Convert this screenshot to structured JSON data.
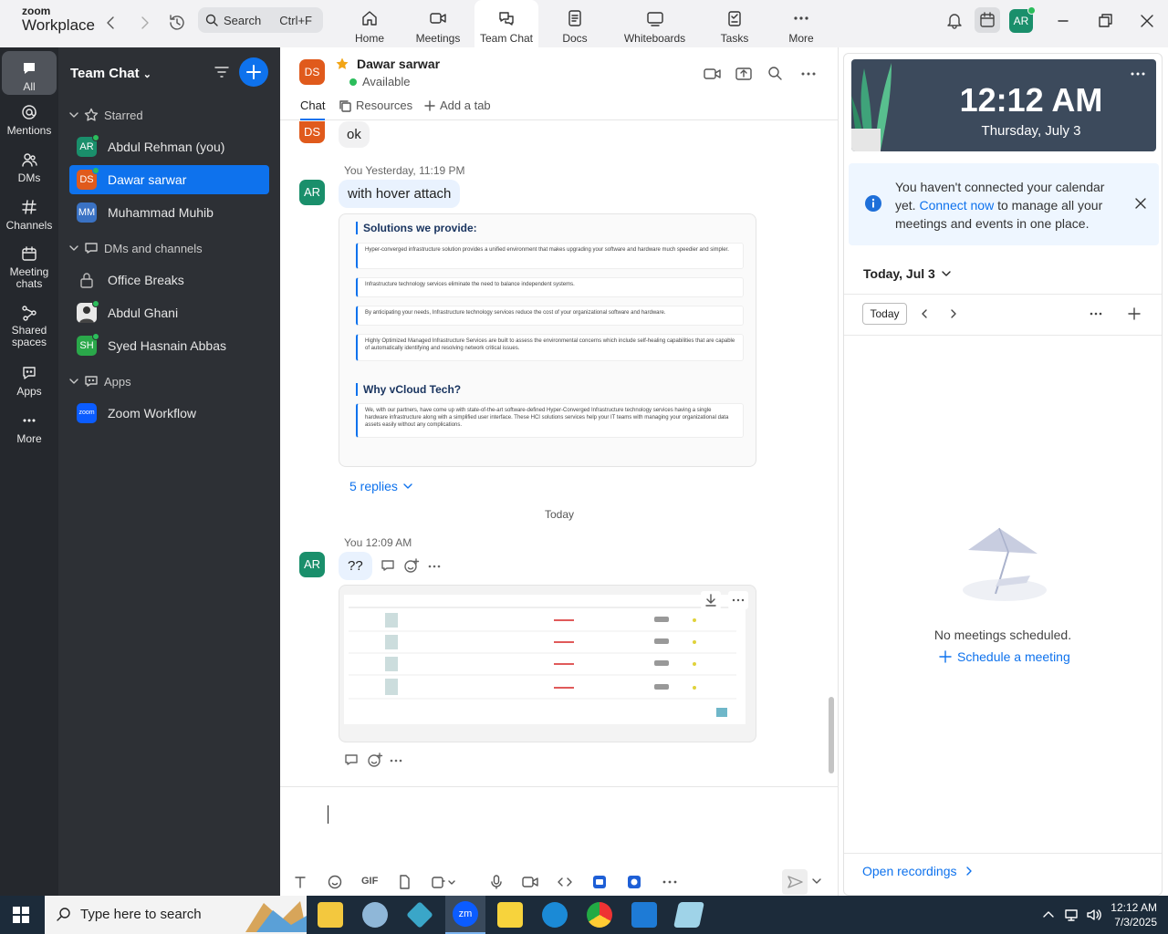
{
  "brand": {
    "line1": "zoom",
    "line2": "Workplace"
  },
  "search": {
    "label": "Search",
    "shortcut": "Ctrl+F"
  },
  "topnav": [
    {
      "label": "Home",
      "icon": "home-icon"
    },
    {
      "label": "Meetings",
      "icon": "video-camera-icon"
    },
    {
      "label": "Team Chat",
      "icon": "chat-bubbles-icon",
      "active": true
    },
    {
      "label": "Docs",
      "icon": "document-icon"
    },
    {
      "label": "Whiteboards",
      "icon": "whiteboard-icon"
    },
    {
      "label": "Tasks",
      "icon": "tasks-icon"
    },
    {
      "label": "More",
      "icon": "more-dots-icon"
    }
  ],
  "user": {
    "initials": "AR"
  },
  "rail": [
    {
      "label": "All",
      "active": true
    },
    {
      "label": "Mentions"
    },
    {
      "label": "DMs"
    },
    {
      "label": "Channels"
    },
    {
      "label": "Meeting chats"
    },
    {
      "label": "Shared spaces"
    },
    {
      "label": "Apps"
    },
    {
      "label": "More"
    }
  ],
  "channel_list": {
    "title": "Team Chat",
    "starred_label": "Starred",
    "dms_label": "DMs and channels",
    "apps_label": "Apps",
    "starred": [
      {
        "initials": "AR",
        "name": "Abdul Rehman (you)",
        "color": "#1a8f6b"
      },
      {
        "initials": "DS",
        "name": "Dawar sarwar",
        "color": "#e05a1c",
        "selected": true
      },
      {
        "initials": "MM",
        "name": "Muhammad Muhib",
        "color": "#3a72c4"
      }
    ],
    "dms": [
      {
        "name": "Office Breaks",
        "type": "lock"
      },
      {
        "name": "Abdul Ghani",
        "type": "photo"
      },
      {
        "initials": "SH",
        "name": "Syed Hasnain Abbas",
        "color": "#2aa84a"
      }
    ],
    "apps": [
      {
        "name": "Zoom Workflow",
        "badge": "zoom"
      }
    ]
  },
  "chat": {
    "contact_initials": "DS",
    "contact_name": "Dawar sarwar",
    "status": "Available",
    "tabs": [
      "Chat",
      "Resources",
      "Add a tab"
    ],
    "messages": {
      "ok_text": "ok",
      "meta1": "You Yesterday, 11:19 PM",
      "msg1_initials": "AR",
      "msg1_text": "with hover attach",
      "solutions_title": "Solutions we provide:",
      "solutions": [
        "Hyper-converged infrastructure solution provides a unified environment that makes upgrading your software and hardware much speedier and simpler.",
        "Infrastructure technology services eliminate the need to balance independent systems.",
        "By anticipating your needs, Infrastructure technology services reduce the cost of your organizational software and hardware.",
        "Highly Optimized Managed Infrastructure Services are built to assess the environmental concerns which include self-healing capabilities that are capable of automatically identifying and resolving network critical issues."
      ],
      "why_title": "Why vCloud Tech?",
      "why_text": "We, with our partners, have come up with state-of-the-art software-defined Hyper-Converged Infrastructure technology services having a single hardware infrastructure along with a simplified user interface. These HCI solutions services help your IT teams with managing your organizational data assets easily without any complications.",
      "replies": "5 replies",
      "divider": "Today",
      "meta2": "You 12:09 AM",
      "msg2_initials": "AR",
      "msg2_text": "??"
    },
    "toolbar": [
      "format-text",
      "emoji",
      "GIF",
      "file",
      "screenshot",
      "audio",
      "video",
      "code",
      "app1",
      "app2",
      "more"
    ]
  },
  "calendar": {
    "time": "12:12 AM",
    "date": "Thursday, July 3",
    "notice_pre": "You haven't connected your calendar yet. ",
    "notice_link": "Connect now",
    "notice_post": " to manage all your meetings and events in one place.",
    "today_header": "Today, Jul 3",
    "today_button": "Today",
    "empty": "No meetings scheduled.",
    "schedule": "Schedule a meeting",
    "open_recordings": "Open recordings"
  },
  "taskbar": {
    "search_placeholder": "Type here to search",
    "clock_time": "12:12 AM",
    "clock_date": "7/3/2025"
  }
}
